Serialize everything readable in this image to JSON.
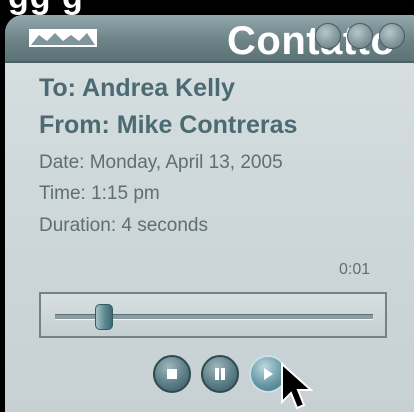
{
  "caption": {
    "top_text": "gg g"
  },
  "window": {
    "title": "Contatto",
    "title_controls": [
      "minimize-icon",
      "maximize-icon",
      "close-icon"
    ]
  },
  "message": {
    "to": "To: Andrea Kelly",
    "from": "From: Mike Contreras",
    "date": "Date: Monday, April 13, 2005",
    "time": "Time: 1:15 pm",
    "duration": "Duration:  4 seconds"
  },
  "player": {
    "elapsed": "0:01",
    "progress_fraction": 0.15,
    "buttons": [
      {
        "name": "stop-button",
        "icon": "stop-icon"
      },
      {
        "name": "pause-button",
        "icon": "pause-icon"
      },
      {
        "name": "play-button",
        "icon": "play-icon"
      }
    ]
  },
  "colors": {
    "background": "#000000",
    "window": "#cfd8da",
    "titlebar": "#6c8388",
    "text_primary": "#4b6a73",
    "text_secondary": "#5d6f74",
    "accent": "#5b7d86"
  }
}
